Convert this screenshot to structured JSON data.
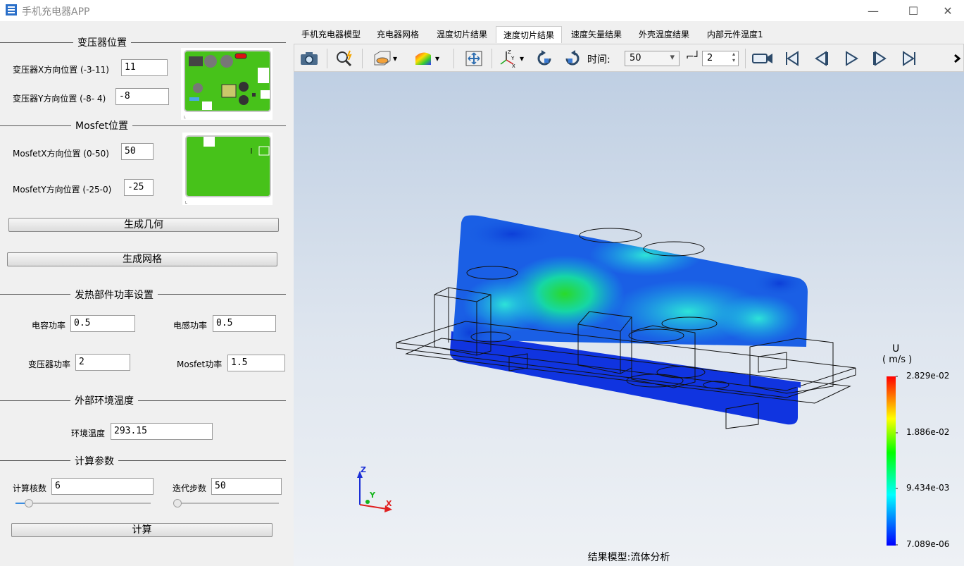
{
  "window": {
    "title": "手机充电器APP",
    "minimize": "—",
    "maximize": "☐",
    "close": "✕"
  },
  "transformer": {
    "group_title": "变压器位置",
    "x_label": "变压器X方向位置 (-3-11)",
    "x_value": "11",
    "y_label": "变压器Y方向位置 (-8- 4)",
    "y_value": "-8"
  },
  "mosfet": {
    "group_title": "Mosfet位置",
    "x_label": "MosfetX方向位置 (0-50)",
    "x_value": "50",
    "y_label": "MosfetY方向位置 (-25-0)",
    "y_value": "-25"
  },
  "buttons": {
    "gen_geometry": "生成几何",
    "gen_mesh": "生成网格",
    "compute": "计算"
  },
  "power": {
    "group_title": "发热部件功率设置",
    "capacitor_label": "电容功率",
    "capacitor_value": "0.5",
    "inductor_label": "电感功率",
    "inductor_value": "0.5",
    "transformer_label": "变压器功率",
    "transformer_value": "2",
    "mosfet_label": "Mosfet功率",
    "mosfet_value": "1.5"
  },
  "ambient": {
    "group_title": "外部环境温度",
    "label": "环境温度",
    "value": "293.15"
  },
  "compute": {
    "group_title": "计算参数",
    "cores_label": "计算核数",
    "cores_value": "6",
    "cores_slider": 0.1,
    "iter_label": "迭代步数",
    "iter_value": "50",
    "iter_slider": 0.0
  },
  "tabs": [
    {
      "label": "手机充电器模型"
    },
    {
      "label": "充电器网格"
    },
    {
      "label": "温度切片结果"
    },
    {
      "label": "速度切片结果",
      "active": true
    },
    {
      "label": "速度矢量结果"
    },
    {
      "label": "外壳温度结果"
    },
    {
      "label": "内部元件温度1"
    }
  ],
  "toolbar": {
    "time_label": "时间:",
    "time_value": "50",
    "step_value": "2"
  },
  "legend": {
    "title": "U",
    "unit": "( m/s )",
    "max": "2.829e-02",
    "mid_high": "1.886e-02",
    "mid_low": "9.434e-03",
    "min": "7.089e-06"
  },
  "axes": {
    "x": "X",
    "y": "Y",
    "z": "Z"
  },
  "caption": "结果模型:流体分析",
  "colors": {
    "accent": "#3b8de0",
    "pcb_green": "#47c21a"
  }
}
